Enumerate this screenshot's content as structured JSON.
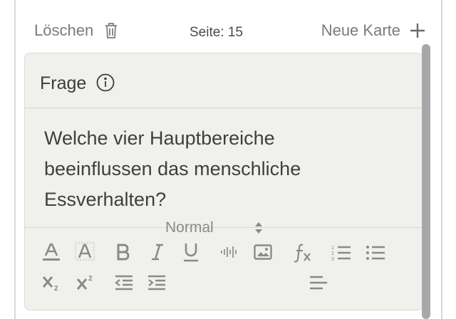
{
  "toolbar": {
    "delete_label": "Löschen",
    "page_label": "Seite: 15",
    "new_card_label": "Neue Karte"
  },
  "card": {
    "section_title": "Frage",
    "question_lines": [
      "Welche vier Hauptbereiche",
      "beeinflussen das menschliche",
      "Essverhalten?"
    ]
  },
  "editor": {
    "style_value": "Normal",
    "icons": [
      "text-color-icon",
      "highlight-color-icon",
      "bold-icon",
      "italic-icon",
      "underline-icon",
      "audio-icon",
      "image-icon",
      "formula-icon",
      "ordered-list-icon",
      "bullet-list-icon",
      "subscript-icon",
      "superscript-icon",
      "outdent-icon",
      "indent-icon",
      "align-icon"
    ]
  },
  "colors": {
    "card_bg": "#f0f0ec",
    "icon_gray": "#8a8a8a",
    "text_dark": "#3f3f3f"
  }
}
